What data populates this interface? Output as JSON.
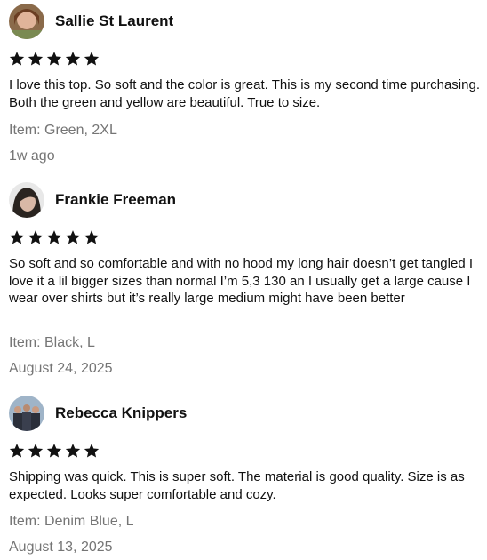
{
  "reviews": [
    {
      "author": "Sallie St Laurent",
      "rating": 5,
      "text": "I love this top. So soft and the color is great. This is my second time purchasing. Both the green and yellow are beautiful. True to size.",
      "item": "Item: Green, 2XL",
      "date": "1w ago",
      "avatar_icon": "user-photo-icon"
    },
    {
      "author": "Frankie Freeman",
      "rating": 5,
      "text": "So soft and so comfortable and with no hood my long hair doesn’t get tangled I love it a lil bigger sizes than normal I’m 5,3 130 an I usually get a large cause I wear over shirts but it’s really large medium might have been better",
      "item": "Item: Black, L",
      "date": "August 24, 2025",
      "avatar_icon": "user-photo-icon"
    },
    {
      "author": "Rebecca Knippers",
      "rating": 5,
      "text": "Shipping was quick. This is super soft. The material is good quality. Size is as expected. Looks super comfortable and cozy.",
      "item": "Item: Denim Blue, L",
      "date": "August 13, 2025",
      "avatar_icon": "group-photo-icon"
    }
  ],
  "colors": {
    "star": "#111111",
    "meta_text": "#757575"
  }
}
